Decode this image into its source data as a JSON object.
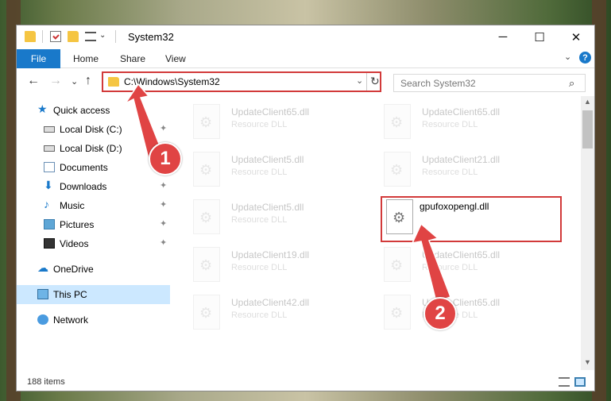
{
  "window": {
    "title": "System32"
  },
  "quick_access_toolbar": {
    "icons": [
      "folder-icon",
      "properties-icon",
      "new-folder-icon",
      "view-icon",
      "customize-dropdown-icon"
    ]
  },
  "window_controls": {
    "minimize": "─",
    "maximize": "☐",
    "close": "✕"
  },
  "ribbon": {
    "tabs": [
      "File",
      "Home",
      "Share",
      "View"
    ],
    "expand_icon": "⌄",
    "help": "?"
  },
  "navigation": {
    "back": "←",
    "forward": "→",
    "recent": "⌄",
    "up": "↑",
    "address": "C:\\Windows\\System32",
    "address_dropdown": "⌄",
    "refresh": "↻",
    "search_placeholder": "Search System32",
    "search_icon": "⌕"
  },
  "sidebar": {
    "items": [
      {
        "label": "Quick access",
        "icon": "star-icon",
        "pinned": false
      },
      {
        "label": "Local Disk (C:)",
        "icon": "drive-icon",
        "pinned": true
      },
      {
        "label": "Local Disk (D:)",
        "icon": "drive-icon",
        "pinned": true
      },
      {
        "label": "Documents",
        "icon": "documents-icon",
        "pinned": true
      },
      {
        "label": "Downloads",
        "icon": "downloads-icon",
        "pinned": true
      },
      {
        "label": "Music",
        "icon": "music-icon",
        "pinned": true
      },
      {
        "label": "Pictures",
        "icon": "pictures-icon",
        "pinned": true
      },
      {
        "label": "Videos",
        "icon": "videos-icon",
        "pinned": true
      },
      {
        "label": "OneDrive",
        "icon": "onedrive-icon",
        "pinned": false
      },
      {
        "label": "This PC",
        "icon": "this-pc-icon",
        "pinned": false,
        "selected": true
      },
      {
        "label": "Network",
        "icon": "network-icon",
        "pinned": false
      }
    ],
    "pin_glyph": "📌"
  },
  "files": [
    {
      "name": "UpdateClient65.dll",
      "type": "Resource DLL",
      "faded": true
    },
    {
      "name": "UpdateClient65.dll",
      "type": "Resource DLL",
      "faded": true
    },
    {
      "name": "UpdateClient5.dll",
      "type": "Resource DLL",
      "faded": true
    },
    {
      "name": "UpdateClient21.dll",
      "type": "Resource DLL",
      "faded": true
    },
    {
      "name": "UpdateClient5.dll",
      "type": "Resource DLL",
      "faded": true
    },
    {
      "name": "gpufoxopengl.dll",
      "type": "",
      "faded": false,
      "highlighted": true
    },
    {
      "name": "UpdateClient19.dll",
      "type": "Resource DLL",
      "faded": true
    },
    {
      "name": "UpdateClient65.dll",
      "type": "Resource DLL",
      "faded": true
    },
    {
      "name": "UpdateClient42.dll",
      "type": "Resource DLL",
      "faded": true
    },
    {
      "name": "UpdateClient65.dll",
      "type": "Resource DLL",
      "faded": true
    }
  ],
  "status": {
    "item_count": "188 items"
  },
  "callouts": {
    "step1": "1",
    "step2": "2"
  },
  "colors": {
    "accent": "#1979ca",
    "highlight": "#d23a3a",
    "selected_bg": "#cce8ff"
  }
}
